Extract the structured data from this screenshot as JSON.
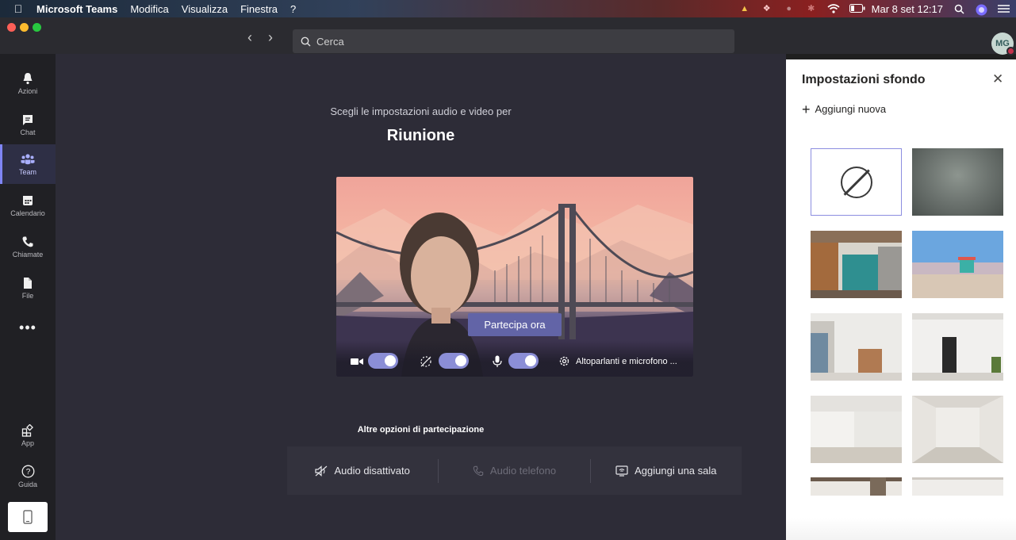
{
  "menubar": {
    "app_name": "Microsoft Teams",
    "menus": [
      "Modifica",
      "Visualizza",
      "Finestra",
      "?"
    ],
    "clock": "Mar 8 set  12:17"
  },
  "titlebar": {
    "search_placeholder": "Cerca",
    "avatar_initials": "MG"
  },
  "rail": {
    "items": [
      {
        "label": "Azioni",
        "icon": "bell-icon"
      },
      {
        "label": "Chat",
        "icon": "chat-icon"
      },
      {
        "label": "Team",
        "icon": "teams-icon"
      },
      {
        "label": "Calendario",
        "icon": "calendar-icon"
      },
      {
        "label": "Chiamate",
        "icon": "phone-icon"
      },
      {
        "label": "File",
        "icon": "file-icon"
      }
    ],
    "active": "Team",
    "bottom": [
      {
        "label": "App",
        "icon": "apps-icon"
      },
      {
        "label": "Guida",
        "icon": "help-icon"
      }
    ]
  },
  "main": {
    "subtitle": "Scegli le impostazioni audio e video per",
    "title": "Riunione",
    "join_button": "Partecipa ora",
    "device_settings": "Altoparlanti e microfono ...",
    "toggles": {
      "camera": true,
      "blur": true,
      "microphone": true
    },
    "other_options_title": "Altre opzioni di partecipazione",
    "other_options": [
      {
        "label": "Audio disattivato",
        "icon": "speaker-off-icon",
        "enabled": true
      },
      {
        "label": "Audio telefono",
        "icon": "phone-icon",
        "enabled": false
      },
      {
        "label": "Aggiungi una sala",
        "icon": "cast-icon",
        "enabled": true
      }
    ]
  },
  "panel": {
    "title": "Impostazioni sfondo",
    "add_new": "Aggiungi nuova",
    "backgrounds": [
      "none",
      "blur",
      "office",
      "beach",
      "room-1",
      "room-2",
      "room-3",
      "room-4"
    ],
    "selected": "none"
  },
  "colors": {
    "accent": "#6264a7",
    "rail_bg": "#202024",
    "main_bg": "#2d2c37",
    "panel_bg": "#ffffff"
  }
}
